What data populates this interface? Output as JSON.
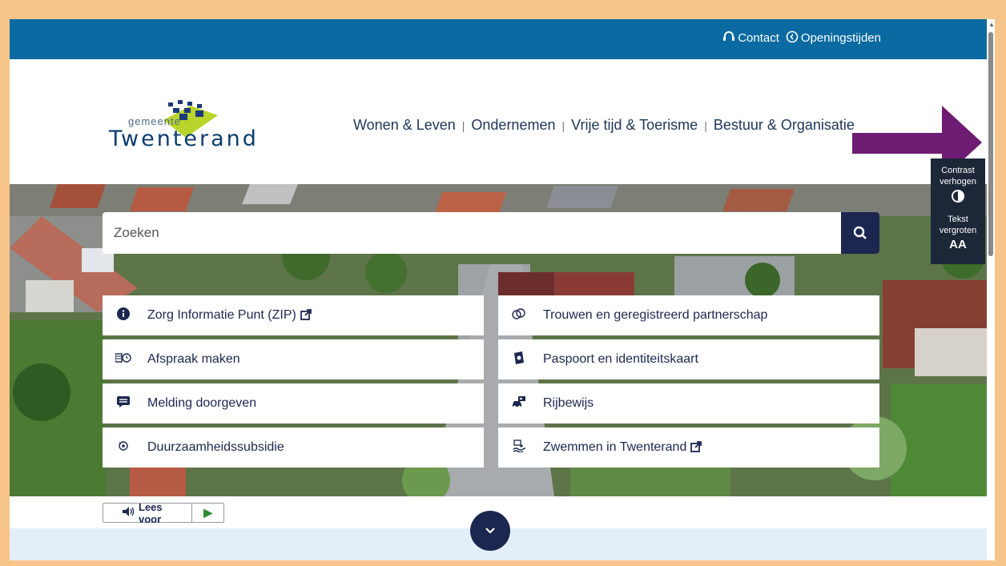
{
  "topbar": {
    "contact_label": "Contact",
    "contact_icon": "headset-icon",
    "hours_label": "Openingstijden",
    "hours_icon": "clock-icon"
  },
  "logo": {
    "line1": "gemeente",
    "line2": "Twenterand"
  },
  "nav": {
    "items": [
      "Wonen & Leven",
      "Ondernemen",
      "Vrije tijd & Toerisme",
      "Bestuur & Organisatie"
    ]
  },
  "annotation_arrow_color": "#6e1c73",
  "search": {
    "placeholder": "Zoeken"
  },
  "tiles_left": [
    {
      "label": "Zorg Informatie Punt (ZIP)",
      "icon": "info-icon",
      "external": true
    },
    {
      "label": "Afspraak maken",
      "icon": "calendar-clock-icon",
      "external": false
    },
    {
      "label": "Melding doorgeven",
      "icon": "chat-bubble-icon",
      "external": false
    },
    {
      "label": "Duurzaamheidssubsidie",
      "icon": "sustainability-icon",
      "external": false
    }
  ],
  "tiles_right": [
    {
      "label": "Trouwen en geregistreerd partnerschap",
      "icon": "rings-icon",
      "external": false
    },
    {
      "label": "Paspoort en identiteitskaart",
      "icon": "passport-icon",
      "external": false
    },
    {
      "label": "Rijbewijs",
      "icon": "car-icon",
      "external": false
    },
    {
      "label": "Zwemmen in Twenterand",
      "icon": "swim-icon",
      "external": true
    }
  ],
  "accessibility": {
    "contrast_label": "Contrast verhogen",
    "text_label": "Tekst vergroten",
    "text_glyph": "AA"
  },
  "lees_voor": {
    "label": "Lees voor"
  },
  "colors": {
    "topbar": "#0a6aa1",
    "navy": "#1c2750",
    "frame": "#f7c58a",
    "band": "#e4eef9"
  }
}
